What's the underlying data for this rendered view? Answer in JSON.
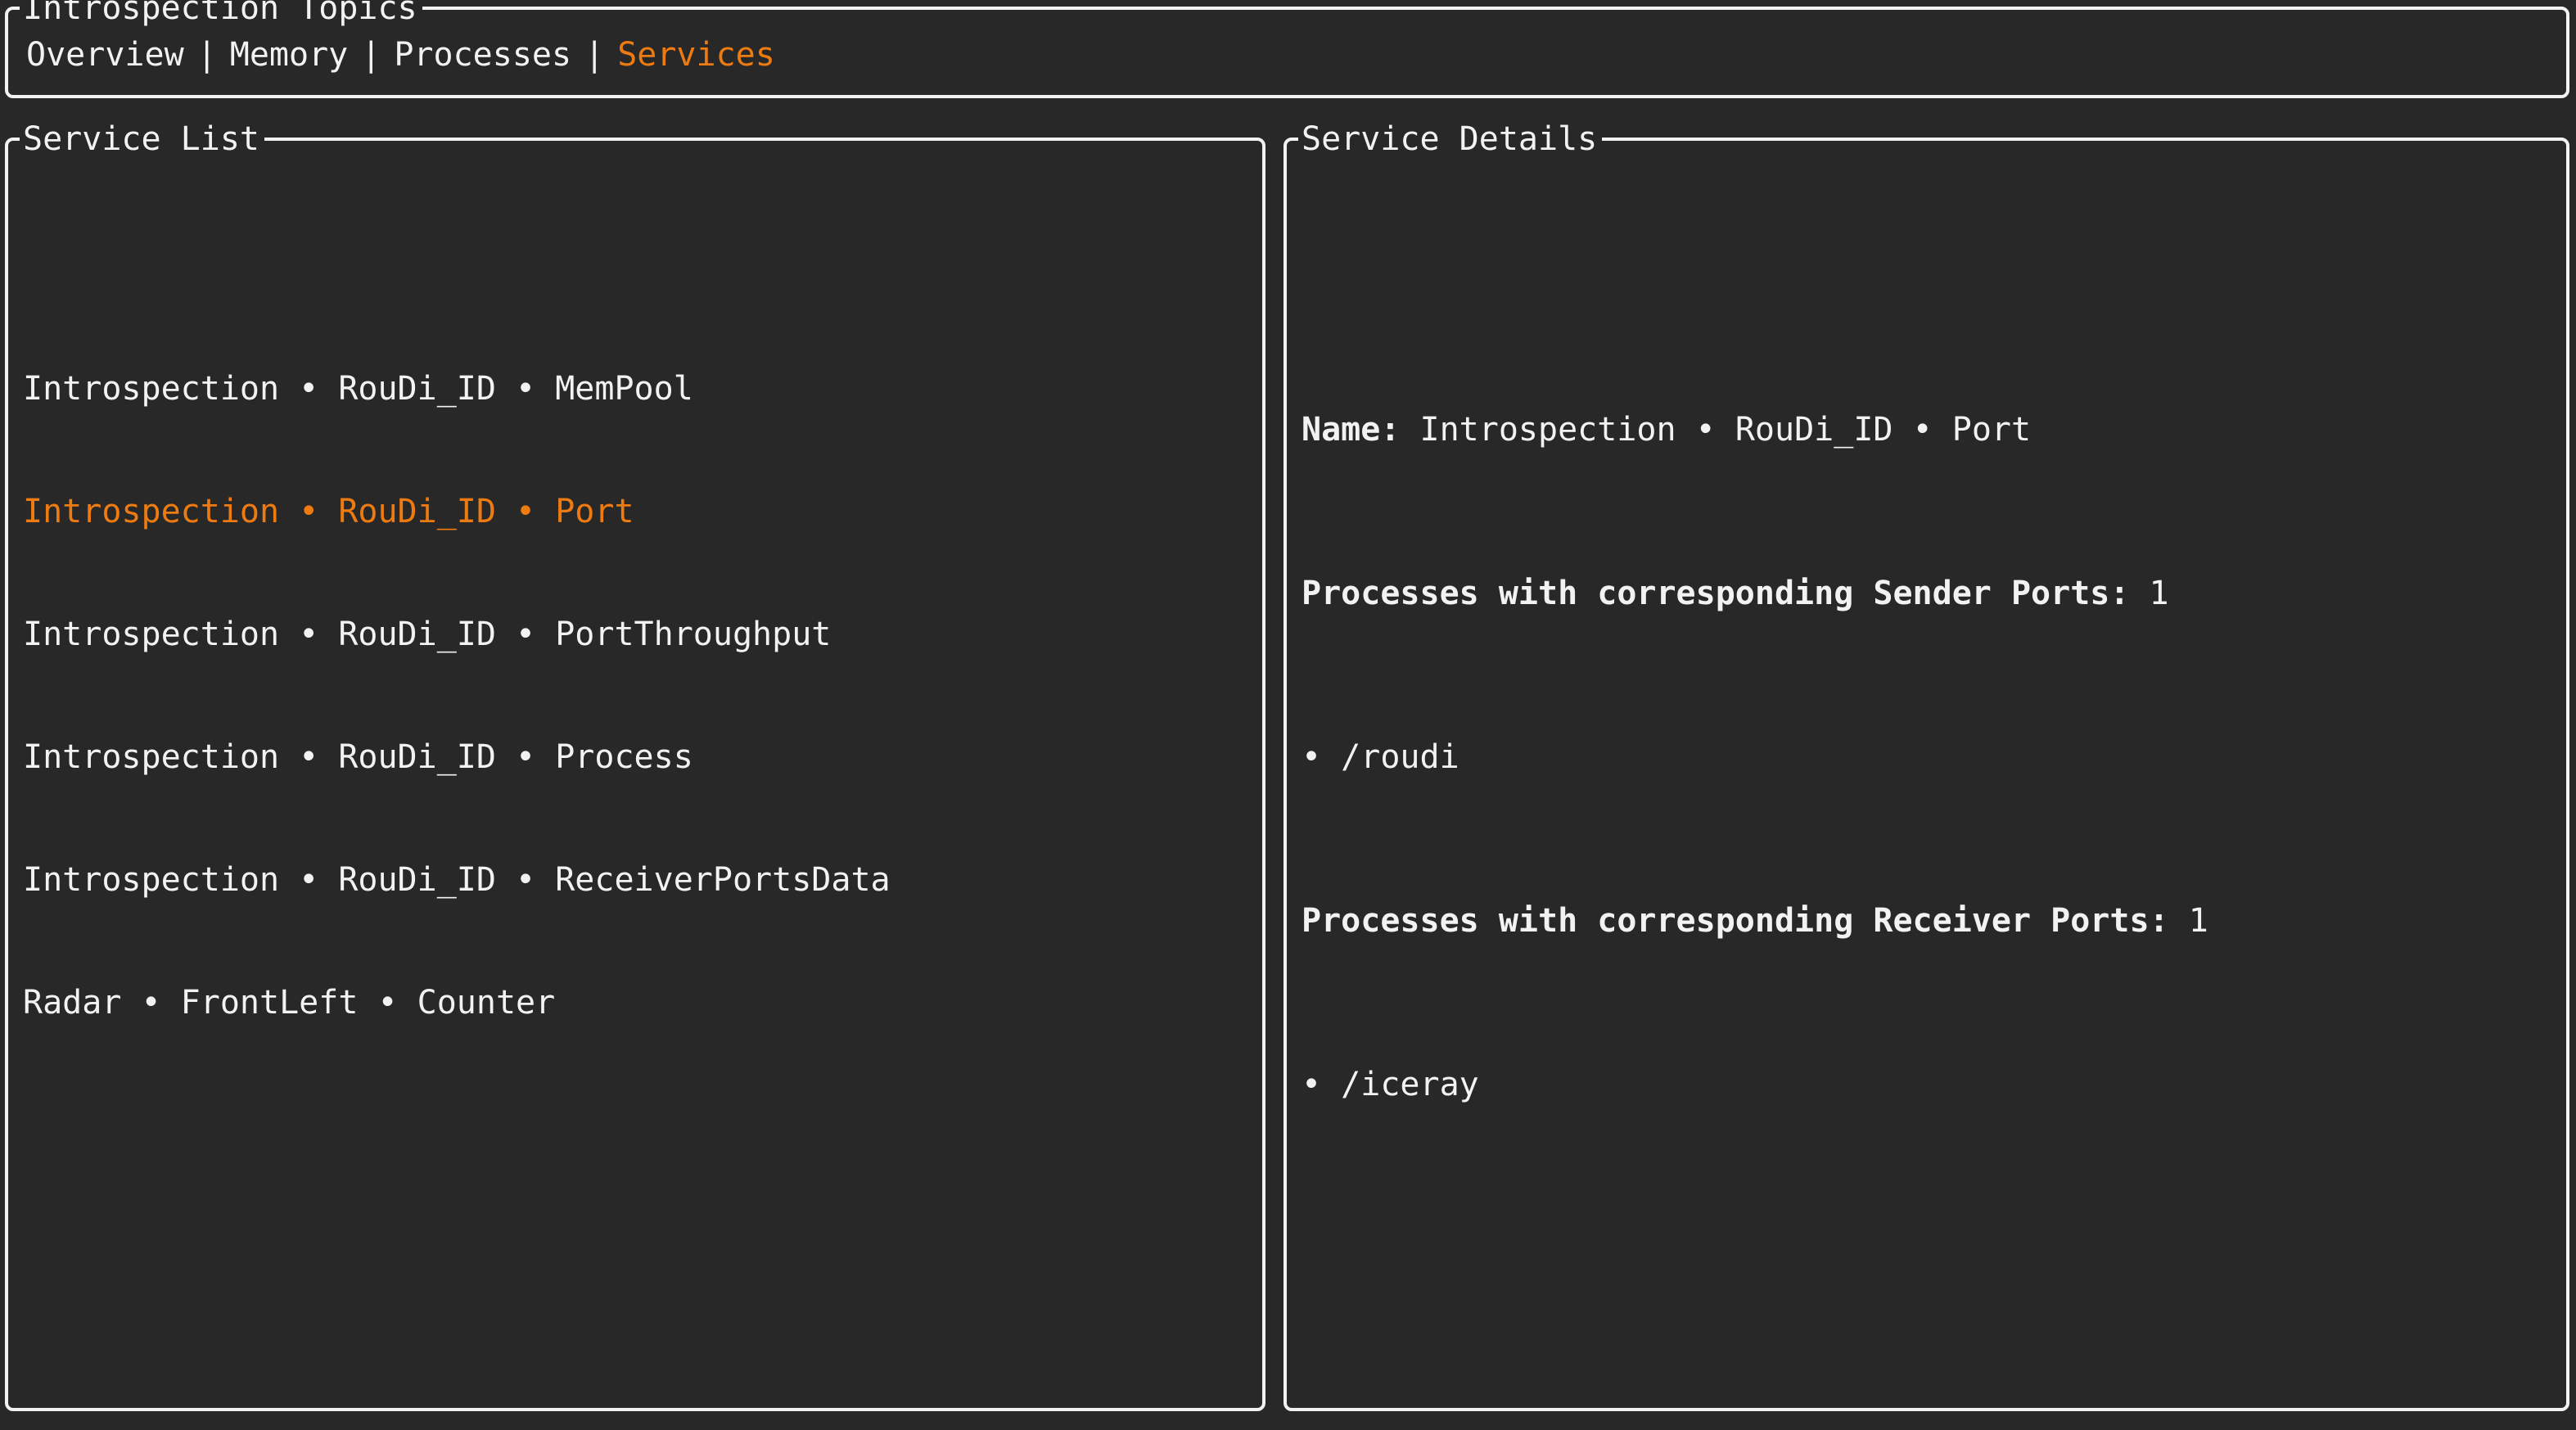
{
  "header": {
    "title": "Introspection Topics",
    "tabs": [
      {
        "label": "Overview",
        "active": false
      },
      {
        "label": "Memory",
        "active": false
      },
      {
        "label": "Processes",
        "active": false
      },
      {
        "label": "Services",
        "active": true
      }
    ],
    "separator": "|"
  },
  "service_list": {
    "title": "Service List",
    "items": [
      {
        "text": "Introspection • RouDi_ID • MemPool",
        "selected": false
      },
      {
        "text": "Introspection • RouDi_ID • Port",
        "selected": true
      },
      {
        "text": "Introspection • RouDi_ID • PortThroughput",
        "selected": false
      },
      {
        "text": "Introspection • RouDi_ID • Process",
        "selected": false
      },
      {
        "text": "Introspection • RouDi_ID • ReceiverPortsData",
        "selected": false
      },
      {
        "text": "Radar • FrontLeft • Counter",
        "selected": false
      }
    ]
  },
  "service_details": {
    "title": "Service Details",
    "name_label": "Name:",
    "name_value": "Introspection • RouDi_ID • Port",
    "sender_label": "Processes with corresponding Sender Ports:",
    "sender_count": "1",
    "sender_processes": [
      "• /roudi"
    ],
    "receiver_label": "Processes with corresponding Receiver Ports:",
    "receiver_count": "1",
    "receiver_processes": [
      "• /iceray"
    ]
  },
  "colors": {
    "background": "#282828",
    "foreground": "#f2f2f2",
    "accent": "#ee7b11"
  }
}
